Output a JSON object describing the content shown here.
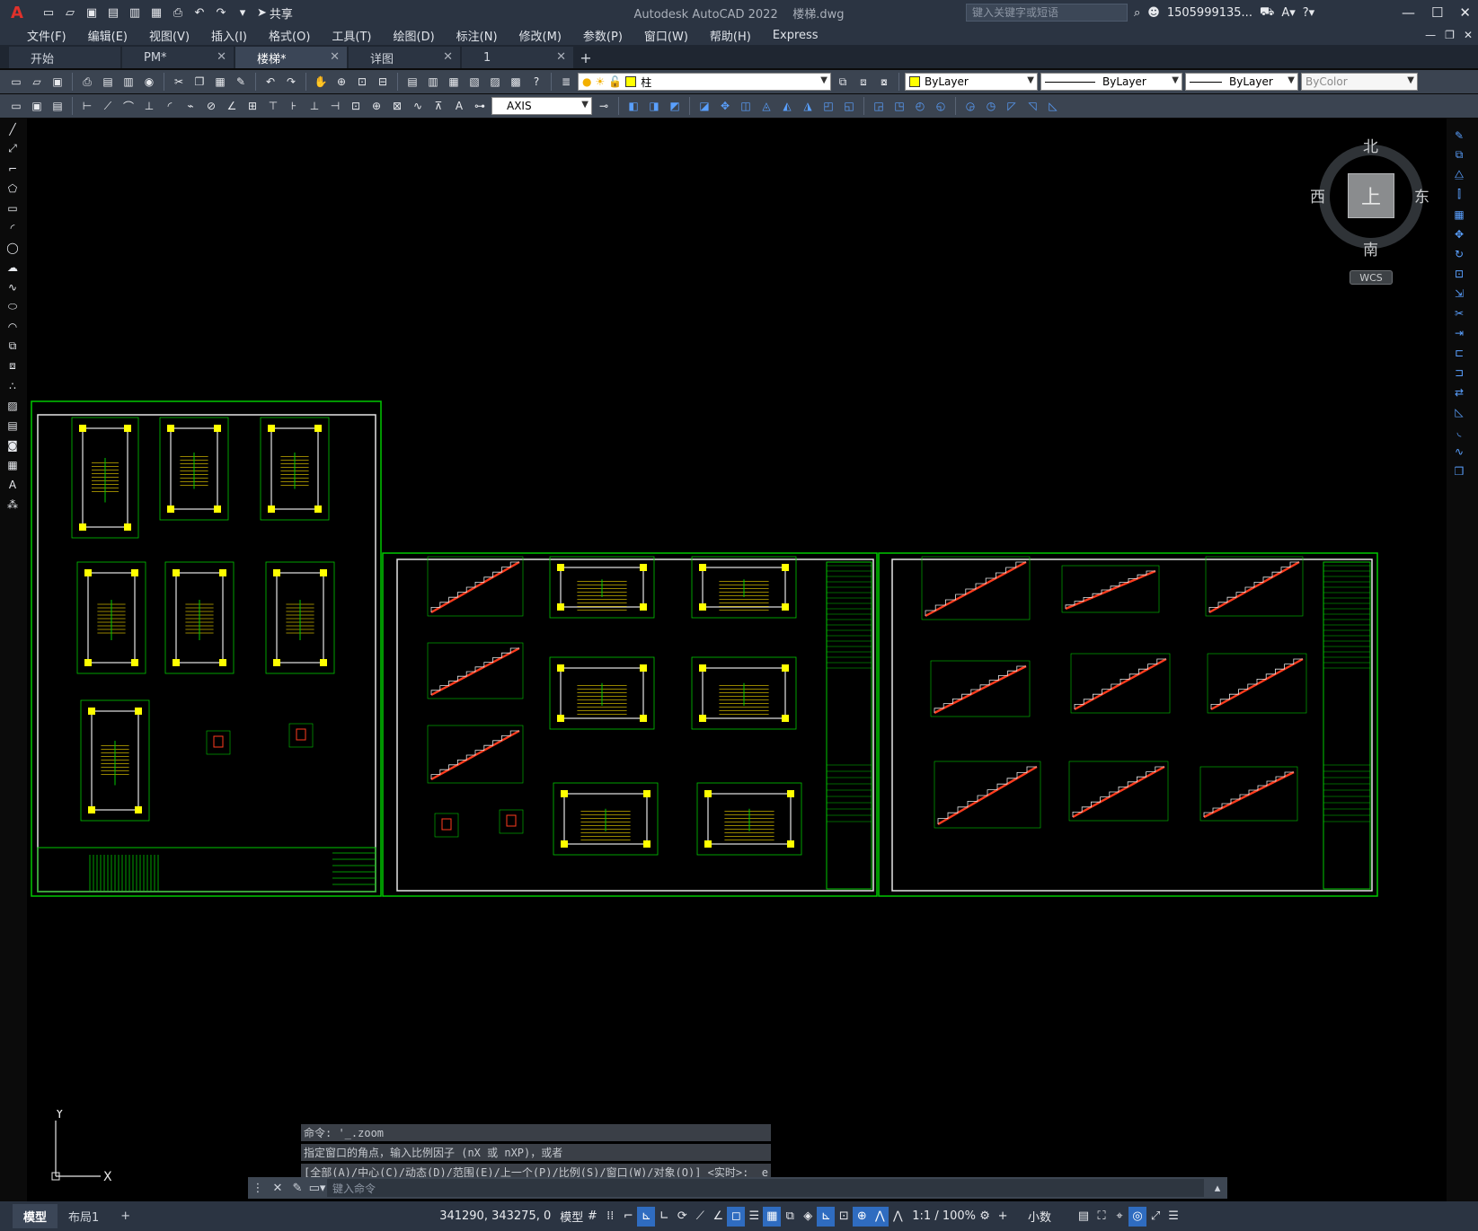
{
  "app": {
    "title": "Autodesk AutoCAD 2022",
    "filename": "楼梯.dwg",
    "search_placeholder": "键入关键字或短语",
    "user": "1505999135...",
    "share_label": "共享"
  },
  "menus": [
    "文件(F)",
    "编辑(E)",
    "视图(V)",
    "插入(I)",
    "格式(O)",
    "工具(T)",
    "绘图(D)",
    "标注(N)",
    "修改(M)",
    "参数(P)",
    "窗口(W)",
    "帮助(H)",
    "Express"
  ],
  "doc_tabs": [
    {
      "label": "开始",
      "closable": false
    },
    {
      "label": "PM*",
      "closable": true
    },
    {
      "label": "楼梯*",
      "closable": true,
      "active": true
    },
    {
      "label": "详图",
      "closable": true
    },
    {
      "label": "1",
      "closable": true
    }
  ],
  "layers": {
    "current_layer": "柱",
    "color": "ByLayer",
    "linetype": "ByLayer",
    "lineweight": "ByLayer",
    "plotstyle": "ByColor",
    "dimstyle": "AXIS"
  },
  "viewcube": {
    "north": "北",
    "south": "南",
    "west": "西",
    "east": "东",
    "face": "上",
    "wcs": "WCS"
  },
  "ucs": {
    "x": "X",
    "y": "Y"
  },
  "command_history": [
    "命令: '_.zoom",
    "指定窗口的角点，输入比例因子 (nX 或 nXP)，或者",
    "[全部(A)/中心(C)/动态(D)/范围(E)/上一个(P)/比例(S)/窗口(W)/对象(O)] <实时>: _e"
  ],
  "command_placeholder": "键入命令",
  "status": {
    "layout_tabs": [
      "模型",
      "布局1"
    ],
    "coords": "341290, 343275, 0",
    "mode": "模型",
    "scale": "1:1 / 100%",
    "units": "小数"
  },
  "colors": {
    "accent": "#2f6cc0",
    "drawing_green": "#00c800",
    "drawing_yellow": "#ffff00",
    "drawing_red": "#ff3c1e"
  }
}
